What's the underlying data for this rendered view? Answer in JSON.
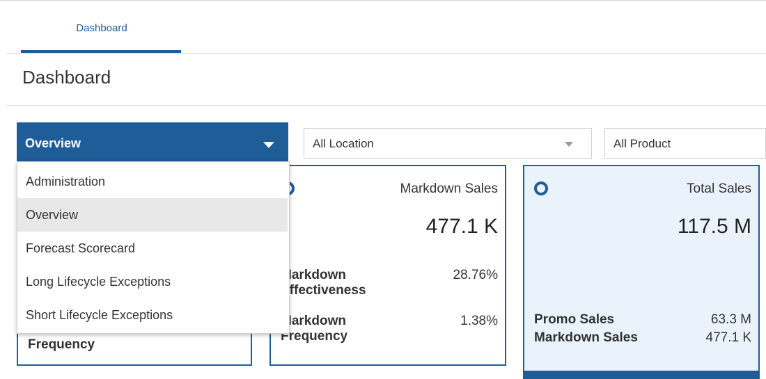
{
  "tabs": [
    {
      "label": "Dashboard"
    }
  ],
  "page_title": "Dashboard",
  "filters": {
    "view": "Overview",
    "location": "All Location",
    "product": "All Product"
  },
  "dropdown_menu": [
    {
      "label": "Administration"
    },
    {
      "label": "Overview"
    },
    {
      "label": "Forecast Scorecard"
    },
    {
      "label": "Long Lifecycle Exceptions"
    },
    {
      "label": "Short Lifecycle Exceptions"
    }
  ],
  "cards": {
    "left": {
      "partial_label": "Frequency"
    },
    "markdown": {
      "title": "Markdown Sales",
      "value": "477.1 K",
      "metrics": [
        {
          "label": "Markdown Effectiveness",
          "label_lines": [
            "Markdown",
            "Effectiveness"
          ],
          "value": "28.76%"
        },
        {
          "label": "Markdown Frequency",
          "label_lines": [
            "Markdown",
            "Frequency"
          ],
          "value": "1.38%"
        }
      ]
    },
    "total": {
      "title": "Total Sales",
      "value": "117.5 M",
      "metrics": [
        {
          "label": "Promo Sales",
          "value": "63.3 M"
        },
        {
          "label": "Markdown Sales",
          "value": "477.1 K"
        }
      ]
    }
  },
  "colors": {
    "primary": "#1f5d99",
    "selected_card_bg": "#eaf3fb",
    "menu_selected_bg": "#e8e8e8"
  }
}
